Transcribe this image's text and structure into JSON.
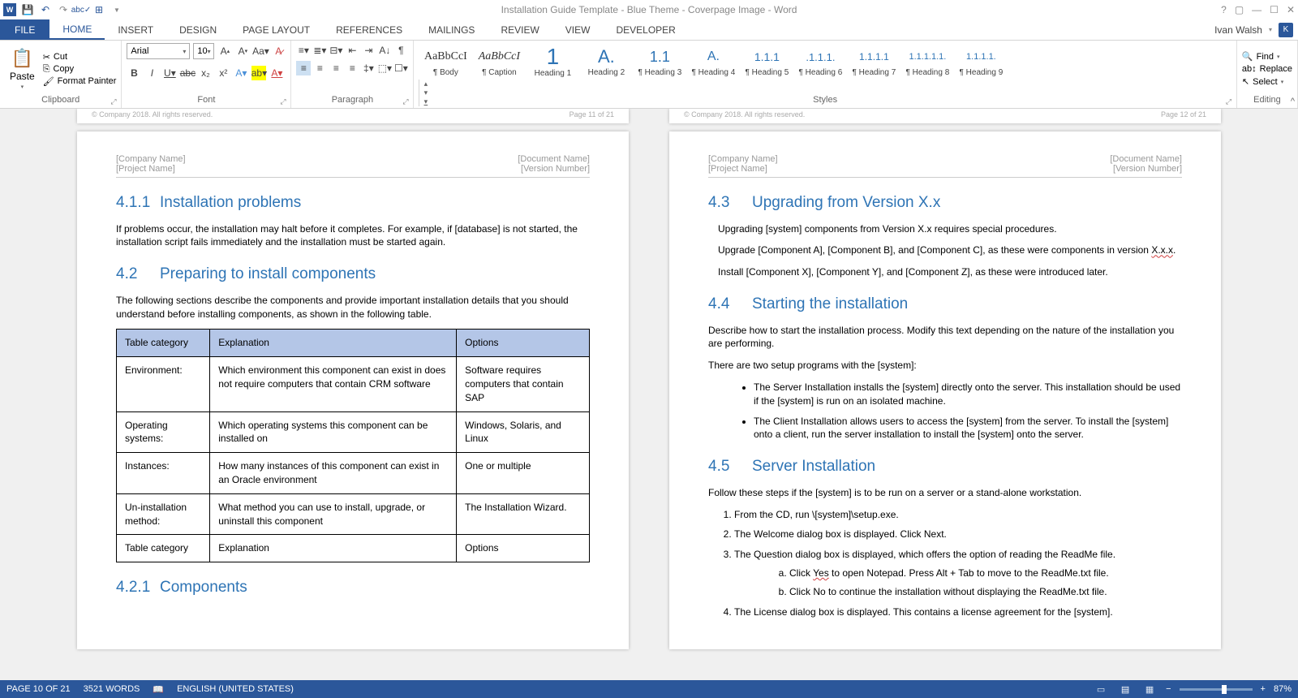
{
  "title": "Installation Guide Template - Blue Theme - Coverpage Image - Word",
  "user": "Ivan Walsh",
  "tabs": [
    "FILE",
    "HOME",
    "INSERT",
    "DESIGN",
    "PAGE LAYOUT",
    "REFERENCES",
    "MAILINGS",
    "REVIEW",
    "VIEW",
    "DEVELOPER"
  ],
  "groups": {
    "clipboard": "Clipboard",
    "font": "Font",
    "para": "Paragraph",
    "styles": "Styles",
    "editing": "Editing"
  },
  "clipboard": {
    "paste": "Paste",
    "cut": "Cut",
    "copy": "Copy",
    "formatPainter": "Format Painter"
  },
  "font": {
    "name": "Arial",
    "size": "10"
  },
  "styles": [
    {
      "p": "AaBbCcI",
      "n": "¶ Body",
      "cls": ""
    },
    {
      "p": "AaBbCcI",
      "n": "¶ Caption",
      "cls": "italic"
    },
    {
      "p": "1",
      "n": "Heading 1",
      "cls": "blue",
      "sz": "28px"
    },
    {
      "p": "A.",
      "n": "Heading 2",
      "cls": "blue",
      "sz": "22px"
    },
    {
      "p": "1.1",
      "n": "¶ Heading 3",
      "cls": "blue",
      "sz": "18px"
    },
    {
      "p": "A.",
      "n": "¶ Heading 4",
      "cls": "blue",
      "sz": "16px"
    },
    {
      "p": "1.1.1",
      "n": "¶ Heading 5",
      "cls": "blue",
      "sz": "14px"
    },
    {
      "p": ".1.1.1.",
      "n": "¶ Heading 6",
      "cls": "blue",
      "sz": "13px"
    },
    {
      "p": "1.1.1.1",
      "n": "¶ Heading 7",
      "cls": "blue",
      "sz": "12px"
    },
    {
      "p": "1.1.1.1.1.",
      "n": "¶ Heading 8",
      "cls": "blue",
      "sz": "11px"
    },
    {
      "p": "1.1.1.1.",
      "n": "¶ Heading 9",
      "cls": "blue",
      "sz": "11px"
    }
  ],
  "editing": {
    "find": "Find",
    "replace": "Replace",
    "select": "Select"
  },
  "headerLeft1": "[Company Name]",
  "headerLeft2": "[Project Name]",
  "headerRight1": "[Document Name]",
  "headerRight2": "[Version Number]",
  "footer": {
    "copyright": "© Company 2018. All rights reserved.",
    "pg11": "Page 11 of 21",
    "pg12": "Page 12 of 21"
  },
  "pA": {
    "h411": {
      "n": "4.1.1",
      "t": "Installation problems"
    },
    "p411": "If problems occur, the installation may halt before it completes. For example, if [database] is not started, the installation script fails immediately and the installation must be started again.",
    "h42": {
      "n": "4.2",
      "t": "Preparing to install components"
    },
    "p42": "The following sections describe the components and provide important installation details that you should understand before installing components, as shown in the following table.",
    "thead": [
      "Table category",
      "Explanation",
      "Options"
    ],
    "rows": [
      [
        "Environment:",
        "Which environment this component can exist in does not require computers that contain CRM software",
        "Software requires computers that contain SAP"
      ],
      [
        "Operating systems:",
        "Which operating systems this component can be installed on",
        "Windows, Solaris, and Linux"
      ],
      [
        "Instances:",
        "How many instances of this component can exist in an Oracle environment",
        "One or multiple"
      ],
      [
        "Un-installation method:",
        "What method you can use to install, upgrade, or uninstall this component",
        "The Installation Wizard."
      ],
      [
        "Table category",
        "Explanation",
        "Options"
      ]
    ],
    "h421": {
      "n": "4.2.1",
      "t": "Components"
    }
  },
  "pB": {
    "h43": {
      "n": "4.3",
      "t": "Upgrading from Version X.x"
    },
    "p43a": "Upgrading [system] components from Version X.x requires special procedures.",
    "p43b_a": "Upgrade [Component A], [Component B], and [Component C], as these were components in version ",
    "p43b_u": "X.x.x",
    "p43b_c": ".",
    "p43c": "Install [Component X], [Component Y], and [Component Z], as these were introduced later.",
    "h44": {
      "n": "4.4",
      "t": "Starting the installation"
    },
    "p44a": "Describe how to start the installation process. Modify this text depending on the nature of the installation you are performing.",
    "p44b": "There are two setup programs with the [system]:",
    "b44": [
      "The Server Installation installs the [system] directly onto the server. This installation should be used if the [system] is run on an isolated machine.",
      "The Client Installation allows users to access the [system] from the server. To install the [system] onto a client, run the server installation to install the [system] onto the server."
    ],
    "h45": {
      "n": "4.5",
      "t": "Server Installation"
    },
    "p45": "Follow these steps if the [system] is to be run on a server or a stand-alone workstation.",
    "ol": [
      "From the CD, run \\[system]\\setup.exe.",
      "The Welcome dialog box is displayed. Click Next.",
      "The Question dialog box is displayed, which offers the option of reading the ReadMe file."
    ],
    "ola_a": "Click ",
    "ola_u": "Yes",
    "ola_c": " to open Notepad. Press Alt + Tab to move to the ReadMe.txt file.",
    "olb": "Click No to continue the installation without displaying the ReadMe.txt file.",
    "ol4": "The License dialog box is displayed. This contains a license agreement for the [system]."
  },
  "status": {
    "page": "PAGE 10 OF 21",
    "words": "3521 WORDS",
    "lang": "ENGLISH (UNITED STATES)",
    "zoom": "87%"
  }
}
